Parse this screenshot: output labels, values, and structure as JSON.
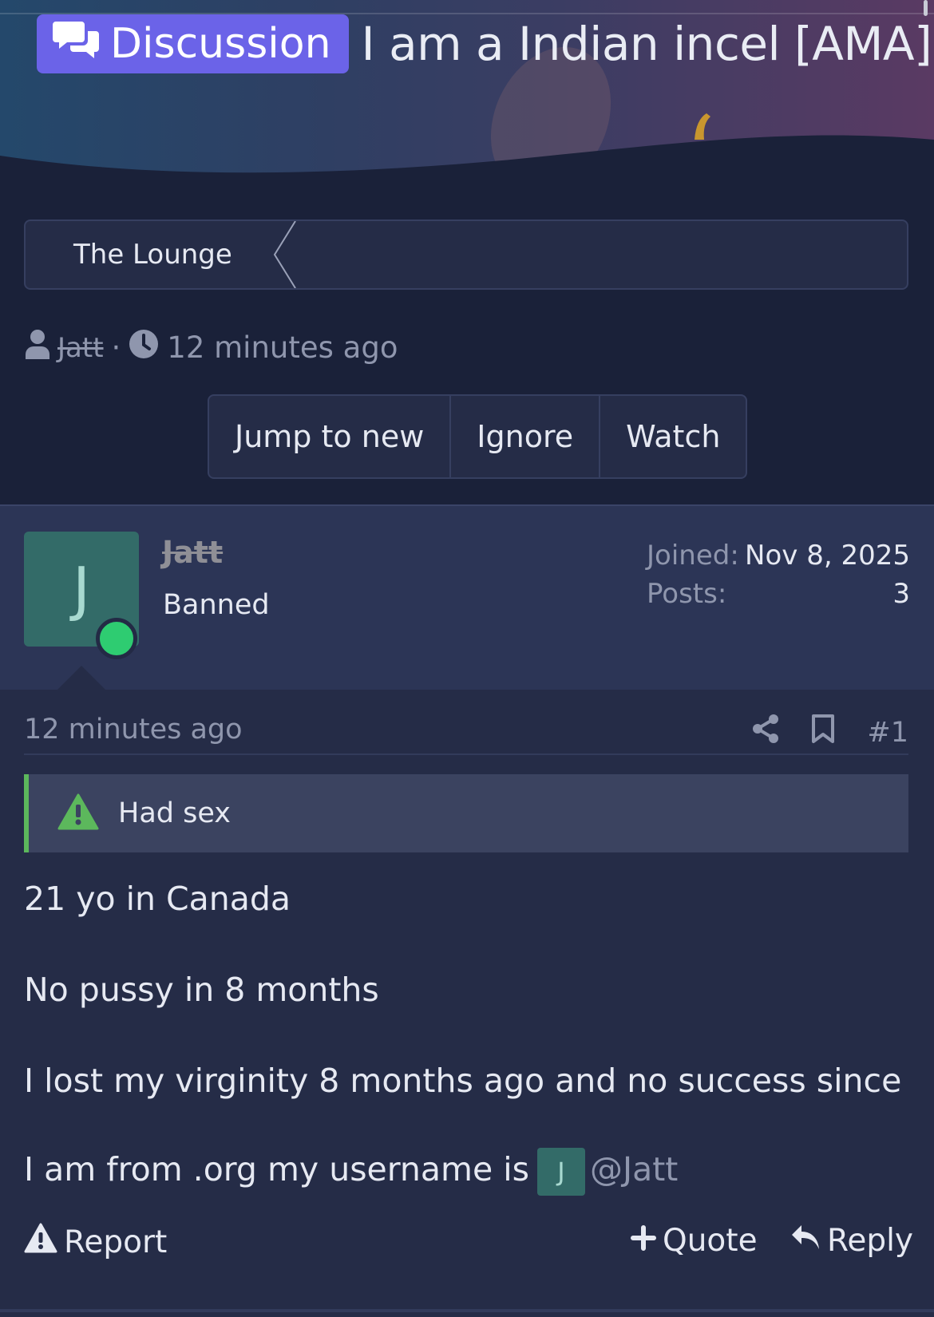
{
  "thread": {
    "prefix": "Discussion",
    "title": "I am a Indian incel [AMA]"
  },
  "breadcrumb": {
    "forum": "The Lounge"
  },
  "meta": {
    "author": "Jatt",
    "separator": "·",
    "time": "12 minutes ago"
  },
  "thread_buttons": {
    "jump": "Jump to new",
    "ignore": "Ignore",
    "watch": "Watch"
  },
  "post": {
    "avatar_letter": "J",
    "username": "Jatt",
    "user_title": "Banned",
    "joined_label": "Joined:",
    "joined_value": "Nov 8, 2025",
    "posts_label": "Posts:",
    "posts_value": "3",
    "time": "12 minutes ago",
    "number": "#1",
    "notice": "Had sex",
    "lines": [
      "21 yo in Canada",
      "No pussy in 8 months",
      "I lost my virginity 8 months ago and no success since"
    ],
    "last_line_prefix": "I am from .org my username is",
    "mention_avatar_letter": "J",
    "mention": "@Jatt",
    "actions": {
      "report": "Report",
      "quote": "Quote",
      "reply": "Reply"
    }
  },
  "colors": {
    "prefix_badge": "#6b63e8",
    "online": "#2ecc71",
    "notice_accent": "#5cb85c",
    "avatar_bg": "#336b68"
  },
  "icons": [
    "comments-icon",
    "user-icon",
    "clock-icon",
    "share-icon",
    "bookmark-icon",
    "warning-icon",
    "plus-icon",
    "reply-icon"
  ]
}
